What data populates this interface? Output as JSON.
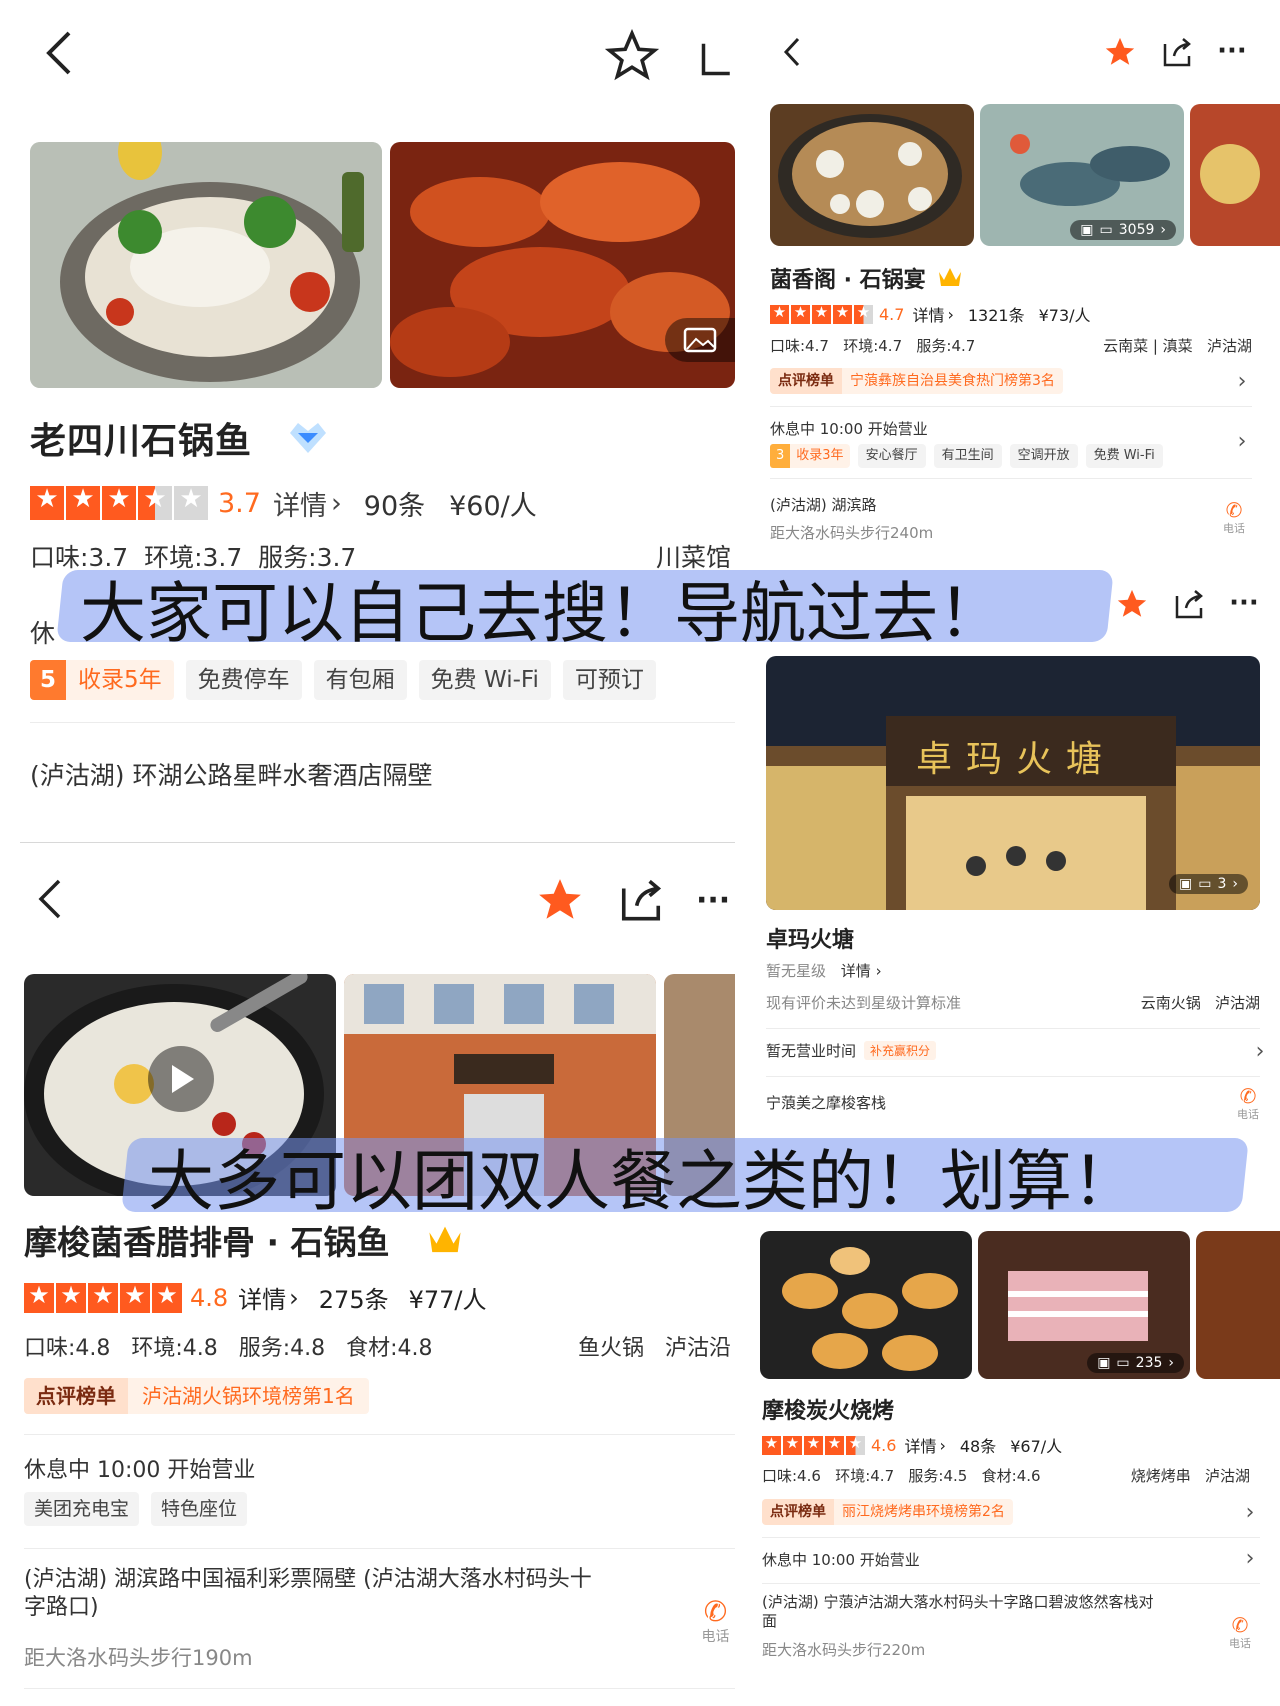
{
  "colors": {
    "accent": "#ff5a1f",
    "highlight": "#7f9cf5",
    "rank_bg": "#fff2e8"
  },
  "p1": {
    "name": "老四川石锅鱼",
    "rating": "3.7",
    "detail": "详情",
    "reviews": "90条",
    "price": "¥60/人",
    "scores": "口味:3.7  环境:3.7  服务:3.7",
    "category": "川菜馆",
    "status_partial": "休",
    "years_num": "5",
    "years_label": "收录5年",
    "tags": [
      "免费停车",
      "有包厢",
      "免费 Wi-Fi",
      "可预订"
    ],
    "address": "(泸沽湖) 环湖公路星畔水奢酒店隔壁"
  },
  "p2": {
    "name": "菌香阁 · 石锅宴",
    "photo_count": "3059",
    "rating": "4.7",
    "detail": "详情",
    "reviews": "1321条",
    "price": "¥73/人",
    "scores": "口味:4.7   环境:4.7   服务:4.7",
    "category": "云南菜 | 滇菜   泸沽湖",
    "rank_label": "点评榜单",
    "rank_text": "宁蒗彝族自治县美食热门榜第3名",
    "status": "休息中 10:00 开始营业",
    "years_num": "3",
    "years_label": "收录3年",
    "tags": [
      "安心餐厅",
      "有卫生间",
      "空调开放",
      "免费 Wi-Fi"
    ],
    "address": "(泸沽湖) 湖滨路",
    "distance": "距大洛水码头步行240m",
    "phone": "电话"
  },
  "p3": {
    "name": "卓玛火塘",
    "sign": "卓玛火塘",
    "photo_count": "3",
    "no_star": "暂无星级",
    "detail": "详情",
    "note": "现有评价未达到星级计算标准",
    "category": "云南火锅   泸沽湖",
    "hours": "暂无营业时间",
    "points": "补充赢积分",
    "address": "宁蒗美之摩梭客栈",
    "phone": "电话"
  },
  "p4": {
    "name": "摩梭菌香腊排骨 · 石锅鱼",
    "rating": "4.8",
    "detail": "详情",
    "reviews": "275条",
    "price": "¥77/人",
    "scores": "口味:4.8   环境:4.8   服务:4.8   食材:4.8",
    "category": "鱼火锅   泸沽沿",
    "rank_label": "点评榜单",
    "rank_text": "泸沽湖火锅环境榜第1名",
    "status": "休息中 10:00 开始营业",
    "tags": [
      "美团充电宝",
      "特色座位"
    ],
    "address": "(泸沽湖) 湖滨路中国福利彩票隔壁 (泸沽湖大落水村码头十字路口)",
    "distance": "距大洛水码头步行190m",
    "phone": "电话"
  },
  "p5": {
    "name": "摩梭炭火烧烤",
    "photo_count": "235",
    "rating": "4.6",
    "detail": "详情",
    "reviews": "48条",
    "price": "¥67/人",
    "scores": "口味:4.6   环境:4.7   服务:4.5   食材:4.6",
    "category": "烧烤烤串   泸沽湖",
    "rank_label": "点评榜单",
    "rank_text": "丽江烧烤烤串环境榜第2名",
    "status": "休息中 10:00 开始营业",
    "address": "(泸沽湖) 宁蒗泸沽湖大落水村码头十字路口碧波悠然客栈对面",
    "distance": "距大洛水码头步行220m",
    "phone": "电话"
  },
  "overlay": {
    "line1": "大家可以自己去搜！导航过去！",
    "line2": "大多可以团双人餐之类的！划算！"
  }
}
